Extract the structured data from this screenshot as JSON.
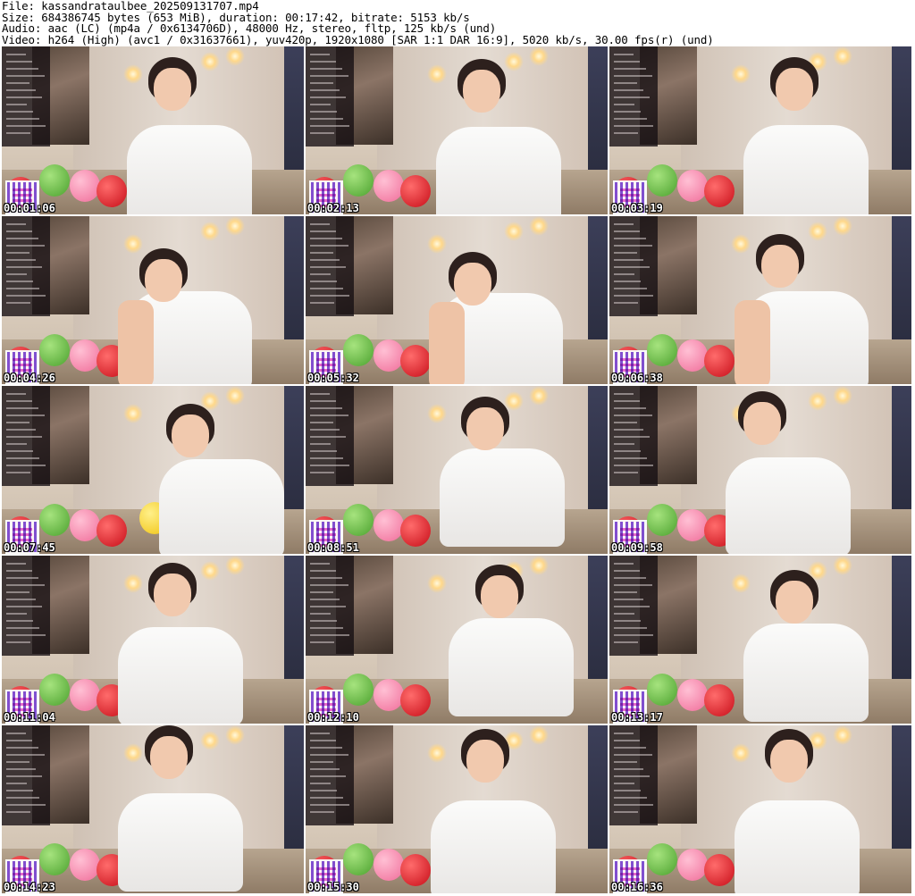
{
  "header": {
    "file_line": "File: kassandrataulbee_202509131707.mp4",
    "size_line": "Size: 684386745 bytes (653 MiB), duration: 00:17:42, bitrate: 5153 kb/s",
    "audio_line": "Audio: aac (LC) (mp4a / 0x6134706D), 48000 Hz, stereo, fltp, 125 kb/s (und)",
    "video_line": "Video: h264 (High) (avc1 / 0x31637661), yuv420p, 1920x1080 [SAR 1:1 DAR 16:9], 5020 kb/s, 30.00 fps(r) (und)"
  },
  "thumbnails": [
    {
      "timestamp": "00:01:06"
    },
    {
      "timestamp": "00:02:13"
    },
    {
      "timestamp": "00:03:19"
    },
    {
      "timestamp": "00:04:26"
    },
    {
      "timestamp": "00:05:32"
    },
    {
      "timestamp": "00:06:38"
    },
    {
      "timestamp": "00:07:45"
    },
    {
      "timestamp": "00:08:51"
    },
    {
      "timestamp": "00:09:58"
    },
    {
      "timestamp": "00:11:04"
    },
    {
      "timestamp": "00:12:10"
    },
    {
      "timestamp": "00:13:17"
    },
    {
      "timestamp": "00:14:23"
    },
    {
      "timestamp": "00:15:30"
    },
    {
      "timestamp": "00:16:36"
    }
  ]
}
